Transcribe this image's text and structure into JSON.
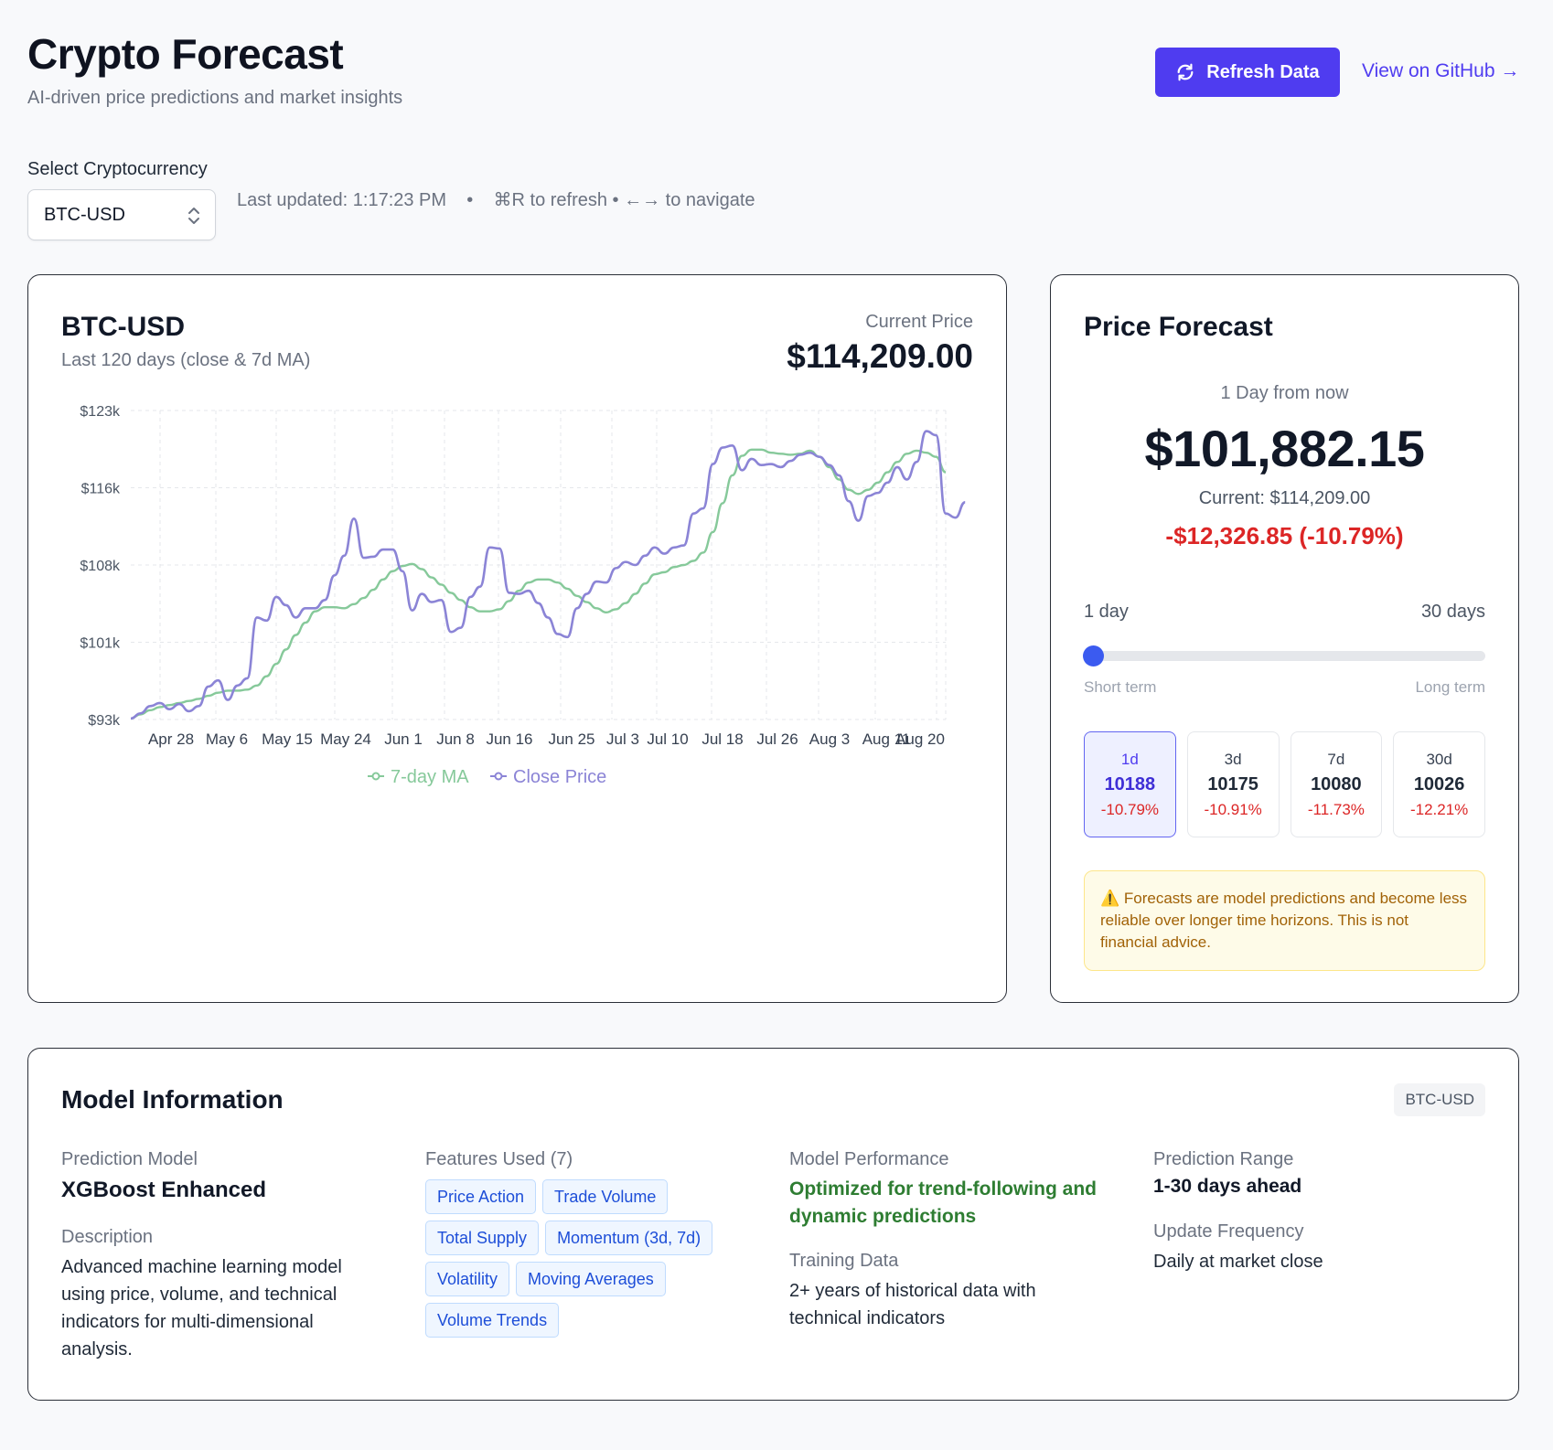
{
  "header": {
    "title": "Crypto Forecast",
    "subtitle": "AI-driven price predictions and market insights",
    "refresh_label": "Refresh Data",
    "github_label": "View on GitHub →"
  },
  "controls": {
    "select_label": "Select Cryptocurrency",
    "selected": "BTC-USD",
    "meta": "Last updated: 1:17:23 PM    •    ⌘R to refresh • ←→ to navigate"
  },
  "chart_card": {
    "title": "BTC-USD",
    "subtitle": "Last 120 days (close & 7d MA)",
    "current_label": "Current Price",
    "current_value": "$114,209.00"
  },
  "chart_data": {
    "type": "line",
    "ylim": [
      93000,
      123000
    ],
    "y_ticks": [
      "$93k",
      "$101k",
      "$108k",
      "$116k",
      "$123k"
    ],
    "y_tick_values": [
      93000,
      100500,
      108000,
      115500,
      123000
    ],
    "x_ticks": [
      "Apr 28",
      "May 6",
      "May 15",
      "May 24",
      "Jun 1",
      "Jun 8",
      "Jun 16",
      "Jun 25",
      "Jul 3",
      "Jul 10",
      "Jul 18",
      "Jul 26",
      "Aug 3",
      "Aug 11",
      "Aug 20"
    ],
    "grid": true,
    "legend_position": "bottom",
    "colors": {
      "close": "#8b84d6",
      "ma": "#86c99a"
    },
    "series": [
      {
        "name": "7-day MA",
        "values": [
          93100,
          93500,
          93900,
          94200,
          94400,
          94600,
          94800,
          95000,
          95300,
          95600,
          95800,
          95800,
          95900,
          96300,
          97200,
          98400,
          99800,
          101200,
          102400,
          103500,
          103900,
          103900,
          103800,
          104200,
          104800,
          105600,
          106600,
          107400,
          107900,
          108100,
          107600,
          106800,
          106100,
          105300,
          104600,
          103900,
          103500,
          103500,
          103700,
          104500,
          105500,
          106300,
          106600,
          106600,
          106300,
          105700,
          105000,
          104400,
          103800,
          103400,
          103700,
          104300,
          105200,
          106200,
          107100,
          107300,
          107800,
          108000,
          108400,
          109200,
          111200,
          114000,
          116700,
          118600,
          119200,
          119200,
          118900,
          118800,
          118700,
          118800,
          119100,
          118500,
          117500,
          116300,
          115300,
          114900,
          115300,
          116000,
          117000,
          118000,
          118800,
          119100,
          118900,
          118500,
          117000
        ]
      },
      {
        "name": "Close Price",
        "values": [
          93100,
          93600,
          94300,
          94600,
          94000,
          94500,
          93800,
          94300,
          96200,
          96800,
          94900,
          96300,
          97000,
          102900,
          102600,
          104900,
          104100,
          102900,
          103800,
          103800,
          104600,
          107000,
          108900,
          112500,
          108700,
          108800,
          109500,
          109500,
          107400,
          103600,
          105200,
          104400,
          104600,
          101500,
          101900,
          104900,
          105900,
          109700,
          109600,
          105300,
          105200,
          105500,
          104300,
          102900,
          101300,
          101000,
          103800,
          105200,
          106400,
          106300,
          107700,
          108300,
          108000,
          108900,
          109700,
          109100,
          109700,
          109900,
          113000,
          113500,
          117800,
          119400,
          119600,
          117200,
          118300,
          117700,
          117800,
          117500,
          118100,
          118700,
          118900,
          118500,
          117700,
          116700,
          114200,
          112300,
          114700,
          115000,
          116000,
          117500,
          116300,
          118000,
          121000,
          120600,
          113000,
          112600,
          114100
        ]
      }
    ]
  },
  "forecast": {
    "title": "Price Forecast",
    "horizon_label": "1 Day from now",
    "value": "$101,882.15",
    "current": "Current: $114,209.00",
    "change": "-$12,326.85 (-10.79%)",
    "slider": {
      "min_label": "1 day",
      "max_label": "30 days",
      "hint_left": "Short term",
      "hint_right": "Long term",
      "value": 1,
      "min": 1,
      "max": 30
    },
    "horizons": [
      {
        "label": "1d",
        "value": "10188",
        "pct": "-10.79%"
      },
      {
        "label": "3d",
        "value": "10175",
        "pct": "-10.91%"
      },
      {
        "label": "7d",
        "value": "10080",
        "pct": "-11.73%"
      },
      {
        "label": "30d",
        "value": "10026",
        "pct": "-12.21%"
      }
    ],
    "warning": "⚠️ Forecasts are model predictions and become less reliable over longer time horizons. This is not financial advice."
  },
  "model": {
    "title": "Model Information",
    "badge": "BTC-USD",
    "prediction_model_label": "Prediction Model",
    "prediction_model": "XGBoost Enhanced",
    "description_label": "Description",
    "description": "Advanced machine learning model using price, volume, and technical indicators for multi-dimensional analysis.",
    "features_label": "Features Used (7)",
    "features": [
      "Price Action",
      "Trade Volume",
      "Total Supply",
      "Momentum (3d, 7d)",
      "Volatility",
      "Moving Averages",
      "Volume Trends"
    ],
    "performance_label": "Model Performance",
    "performance": "Optimized for trend-following and dynamic predictions",
    "training_label": "Training Data",
    "training": "2+ years of historical data with technical indicators",
    "range_label": "Prediction Range",
    "range": "1-30 days ahead",
    "frequency_label": "Update Frequency",
    "frequency": "Daily at market close"
  }
}
